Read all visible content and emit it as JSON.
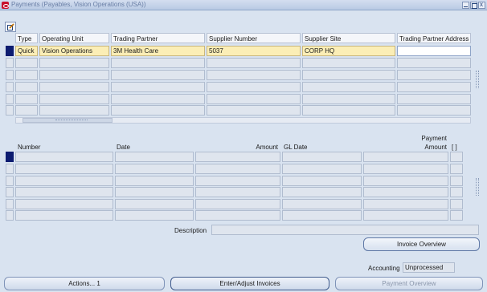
{
  "window": {
    "title": "Payments (Payables, Vision Operations (USA))"
  },
  "payments_table": {
    "columns": [
      "Type",
      "Operating Unit",
      "Trading Partner",
      "Supplier Number",
      "Supplier Site",
      "Trading Partner Address"
    ],
    "rows": [
      [
        "Quick",
        "Vision Operations",
        "3M Health Care",
        "5037",
        "CORP HQ",
        ""
      ],
      [
        "",
        "",
        "",
        "",
        "",
        ""
      ],
      [
        "",
        "",
        "",
        "",
        "",
        ""
      ],
      [
        "",
        "",
        "",
        "",
        "",
        ""
      ],
      [
        "",
        "",
        "",
        "",
        "",
        ""
      ],
      [
        "",
        "",
        "",
        "",
        "",
        ""
      ]
    ]
  },
  "invoices_table": {
    "columns": [
      "Number",
      "Date",
      "Amount",
      "GL Date",
      "Payment Amount",
      "[ ]"
    ],
    "payment_label_top": "Payment",
    "payment_label_bottom": "Amount",
    "rows": [
      [
        "",
        "",
        "",
        "",
        "",
        ""
      ],
      [
        "",
        "",
        "",
        "",
        "",
        ""
      ],
      [
        "",
        "",
        "",
        "",
        "",
        ""
      ],
      [
        "",
        "",
        "",
        "",
        "",
        ""
      ],
      [
        "",
        "",
        "",
        "",
        "",
        ""
      ],
      [
        "",
        "",
        "",
        "",
        "",
        ""
      ]
    ]
  },
  "description": {
    "label": "Description",
    "value": ""
  },
  "accounting": {
    "label": "Accounting",
    "value": "Unprocessed"
  },
  "buttons": {
    "invoice_overview": "Invoice Overview",
    "actions": "Actions... 1",
    "enter_adjust": "Enter/Adjust Invoices",
    "payment_overview": "Payment Overview"
  },
  "colors": {
    "active_row": "#fbeeb6",
    "record_indicator": "#0c1b70",
    "background": "#d9e3f0"
  },
  "icons": [
    "oracle-app-icon",
    "edit-form-icon"
  ]
}
